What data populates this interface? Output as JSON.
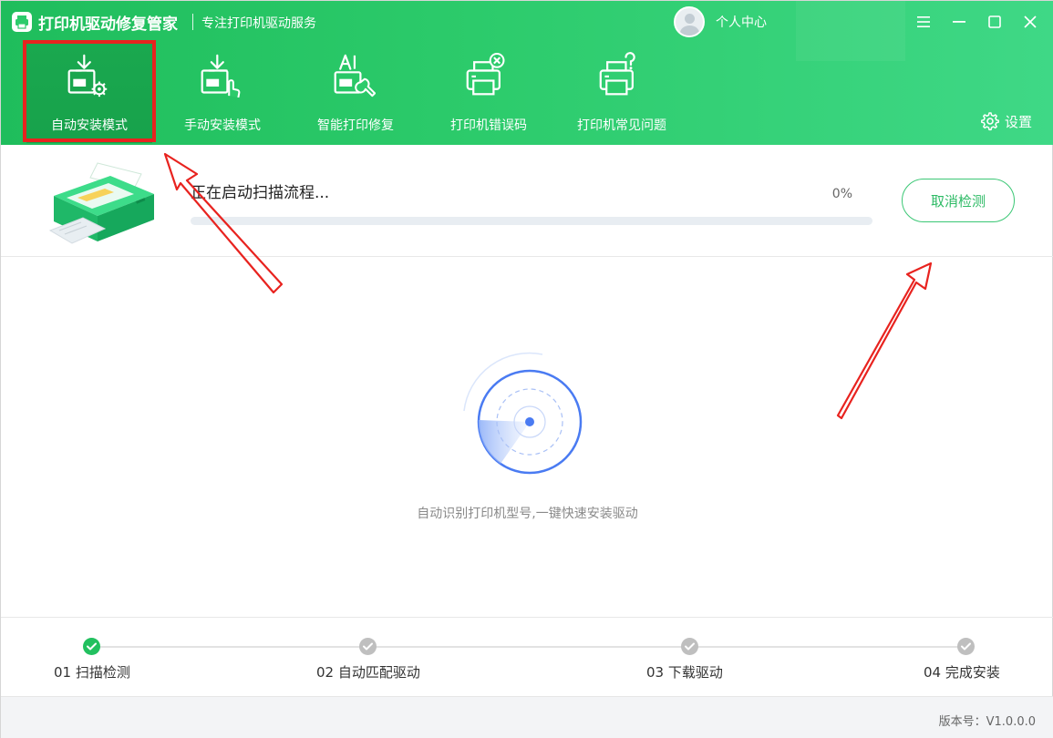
{
  "app": {
    "title": "打印机驱动修复管家",
    "subtitle": "专注打印机驱动服务"
  },
  "user": {
    "label": "个人中心"
  },
  "window_controls": [
    "menu-icon",
    "minimize-icon",
    "maximize-icon",
    "close-icon"
  ],
  "toolbar": {
    "items": [
      {
        "label": "自动安装模式",
        "icon": "auto-install-icon",
        "active": true
      },
      {
        "label": "手动安装模式",
        "icon": "manual-install-icon",
        "active": false
      },
      {
        "label": "智能打印修复",
        "icon": "ai-repair-icon",
        "active": false
      },
      {
        "label": "打印机错误码",
        "icon": "printer-error-icon",
        "active": false
      },
      {
        "label": "打印机常见问题",
        "icon": "printer-faq-icon",
        "active": false
      }
    ],
    "settings_label": "设置"
  },
  "status": {
    "text": "正在启动扫描流程...",
    "progress_percent_text": "0%",
    "progress_fraction": 0,
    "cancel_label": "取消检测"
  },
  "scan": {
    "caption": "自动识别打印机型号,一键快速安装驱动"
  },
  "steps": [
    {
      "label": "01 扫描检测",
      "state": "done"
    },
    {
      "label": "02 自动匹配驱动",
      "state": "pending"
    },
    {
      "label": "03 下载驱动",
      "state": "pending"
    },
    {
      "label": "04 完成安装",
      "state": "pending"
    }
  ],
  "footer": {
    "version": "版本号：V1.0.0.0"
  },
  "colors": {
    "brand_green": "#2ccb6b",
    "active_tab": "#17a24b",
    "accent_blue": "#4a7bf2",
    "annotation_red": "#e8231f"
  }
}
